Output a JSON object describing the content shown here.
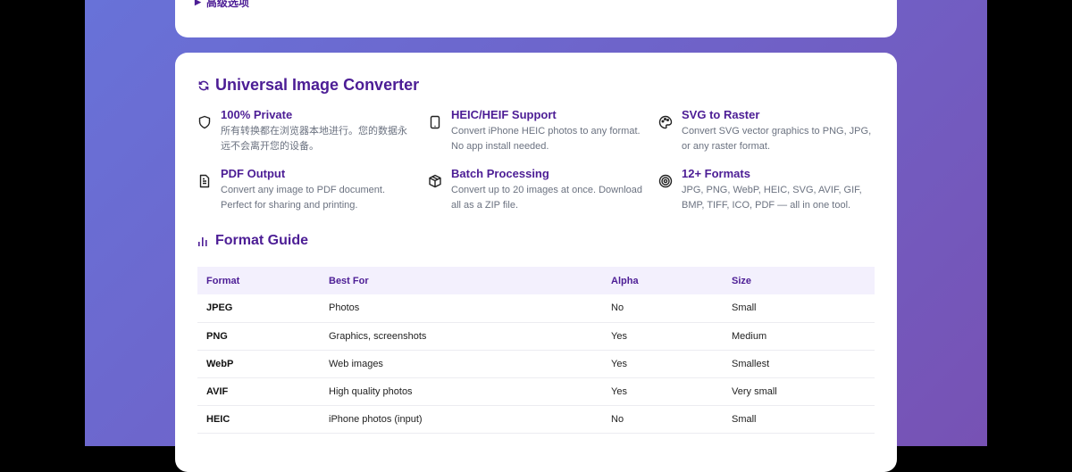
{
  "advanced_options": "高级选项",
  "title": "Universal Image Converter",
  "features": [
    {
      "icon": "shield-icon",
      "title": "100% Private",
      "desc": "所有转换都在浏览器本地进行。您的数据永远不会离开您的设备。"
    },
    {
      "icon": "phone-icon",
      "title": "HEIC/HEIF Support",
      "desc": "Convert iPhone HEIC photos to any format. No app install needed."
    },
    {
      "icon": "palette-icon",
      "title": "SVG to Raster",
      "desc": "Convert SVG vector graphics to PNG, JPG, or any raster format."
    },
    {
      "icon": "document-icon",
      "title": "PDF Output",
      "desc": "Convert any image to PDF document. Perfect for sharing and printing."
    },
    {
      "icon": "package-icon",
      "title": "Batch Processing",
      "desc": "Convert up to 20 images at once. Download all as a ZIP file."
    },
    {
      "icon": "target-icon",
      "title": "12+ Formats",
      "desc": "JPG, PNG, WebP, HEIC, SVG, AVIF, GIF, BMP, TIFF, ICO, PDF — all in one tool."
    }
  ],
  "format_guide": {
    "title": "Format Guide",
    "headers": [
      "Format",
      "Best For",
      "Alpha",
      "Size"
    ],
    "rows": [
      [
        "JPEG",
        "Photos",
        "No",
        "Small"
      ],
      [
        "PNG",
        "Graphics, screenshots",
        "Yes",
        "Medium"
      ],
      [
        "WebP",
        "Web images",
        "Yes",
        "Smallest"
      ],
      [
        "AVIF",
        "High quality photos",
        "Yes",
        "Very small"
      ],
      [
        "HEIC",
        "iPhone photos (input)",
        "No",
        "Small"
      ]
    ]
  }
}
